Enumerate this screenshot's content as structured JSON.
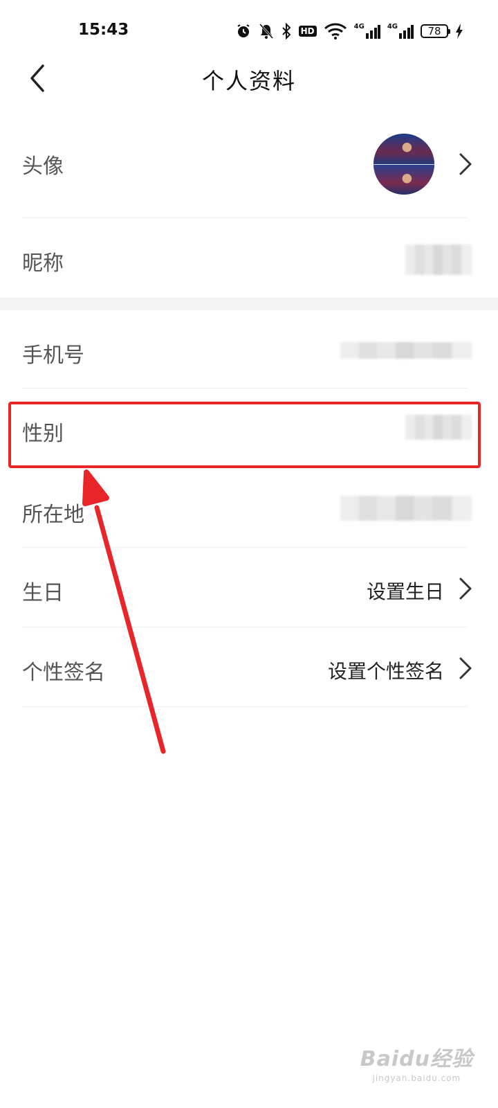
{
  "status": {
    "time": "15:43",
    "icons": [
      "alarm-icon",
      "mute-bell-icon",
      "bluetooth-icon",
      "hd-icon",
      "wifi-icon",
      "4g-signal-icon",
      "4g-signal-icon",
      "battery-icon",
      "charging-icon"
    ],
    "hd_label": "HD",
    "net1_label": "4G",
    "net2_label": "4G",
    "battery": "78"
  },
  "header": {
    "title": "个人资料",
    "back_icon": "chevron-left-icon"
  },
  "rows": {
    "avatar": {
      "label": "头像"
    },
    "nickname": {
      "label": "昵称"
    },
    "phone": {
      "label": "手机号"
    },
    "gender": {
      "label": "性别"
    },
    "location": {
      "label": "所在地"
    },
    "birthday": {
      "label": "生日",
      "value": "设置生日"
    },
    "signature": {
      "label": "个性签名",
      "value": "设置个性签名"
    }
  },
  "annotation": {
    "highlight_color": "#e8262a"
  },
  "watermark": {
    "main": "Baidu经验",
    "sub": "jingyan.baidu.com"
  }
}
